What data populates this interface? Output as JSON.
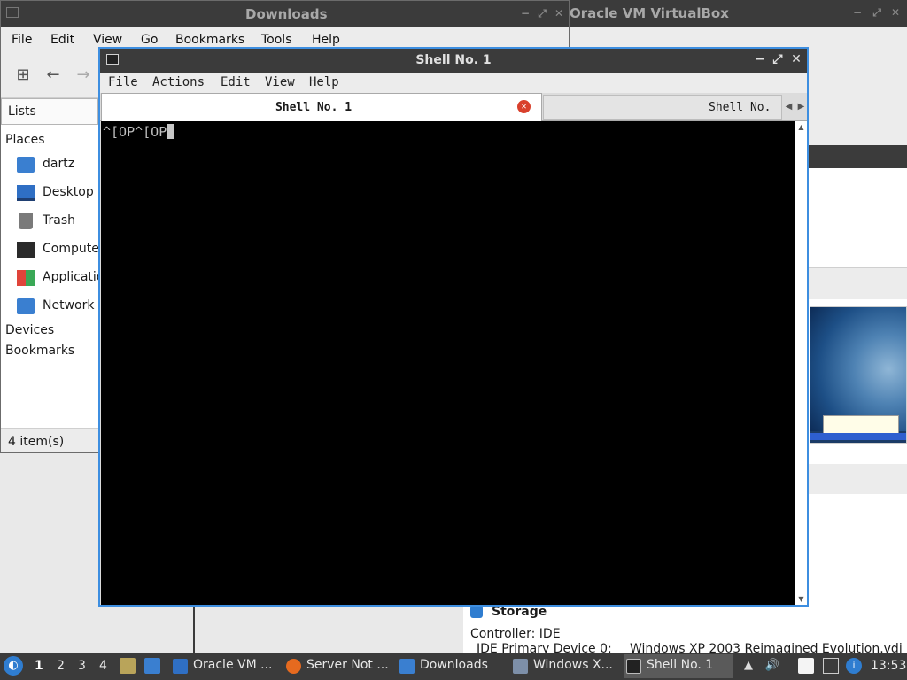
{
  "downloads_window": {
    "title": "Downloads",
    "menu": [
      "File",
      "Edit",
      "View",
      "Go",
      "Bookmarks",
      "Tools",
      "Help"
    ],
    "side_mode": "Lists",
    "sections": {
      "places": "Places",
      "devices": "Devices",
      "bookmarks": "Bookmarks"
    },
    "places": [
      {
        "label": "dartz",
        "icon": "home-folder-icon"
      },
      {
        "label": "Desktop",
        "icon": "desktop-icon"
      },
      {
        "label": "Trash",
        "icon": "trash-icon"
      },
      {
        "label": "Compute",
        "icon": "computer-icon"
      },
      {
        "label": "Applicatio",
        "icon": "applications-icon"
      },
      {
        "label": "Network",
        "icon": "network-icon"
      }
    ],
    "status": "4 item(s)"
  },
  "virtualbox_window": {
    "title": "Oracle VM VirtualBox",
    "storage_heading": "Storage",
    "controller": "Controller: IDE",
    "ide_primary_label": "IDE Primary Device 0:",
    "ide_primary_value": "Windows XP 2003 Reimagined Evolution.vdi"
  },
  "shell_window": {
    "title": "Shell No. 1",
    "menu": [
      "File",
      "Actions",
      "Edit",
      "View",
      "Help"
    ],
    "tabs": [
      {
        "label": "Shell No. 1",
        "active": true
      },
      {
        "label": "Shell No.",
        "active": false
      }
    ],
    "terminal_text": "^[OP^[OP"
  },
  "taskbar": {
    "workspaces": [
      "1",
      "2",
      "3",
      "4"
    ],
    "active_workspace": "1",
    "tasks": [
      {
        "label": "Oracle VM ...",
        "icon": "virtualbox-icon"
      },
      {
        "label": "Server Not ...",
        "icon": "firefox-icon"
      },
      {
        "label": "Downloads",
        "icon": "folder-icon"
      },
      {
        "label": "Windows X...",
        "icon": "windows-xp-icon"
      },
      {
        "label": "Shell No. 1",
        "icon": "terminal-icon",
        "active": true
      }
    ],
    "clock": "13:53"
  },
  "colors": {
    "titlebar": "#3b3b3b",
    "accent": "#3d8ee0",
    "terminal_bg": "#000000",
    "taskbar": "#3b3b3b"
  }
}
